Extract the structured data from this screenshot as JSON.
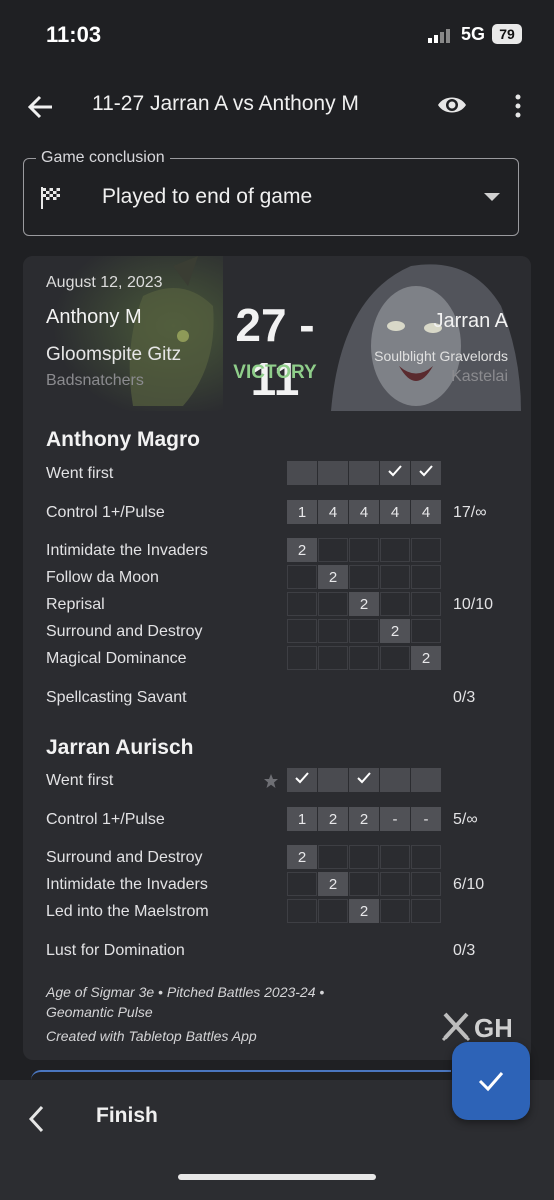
{
  "status_bar": {
    "time": "11:03",
    "network": "5G",
    "battery": "79"
  },
  "app_bar": {
    "title": "11-27 Jarran A vs Anthony M"
  },
  "game_conclusion": {
    "label": "Game conclusion",
    "value": "Played to end of game"
  },
  "summary": {
    "date": "August 12, 2023",
    "score": "27 - 11",
    "result": "VICTORY",
    "player1": {
      "name": "Anthony M",
      "faction": "Gloomspite Gitz",
      "subfaction": "Badsnatchers"
    },
    "player2": {
      "name": "Jarran A",
      "faction": "Soulblight Gravelords",
      "subfaction": "Kastelai"
    }
  },
  "players": [
    {
      "name": "Anthony Magro",
      "went_first_label": "Went first",
      "went_first": [
        false,
        false,
        false,
        true,
        true
      ],
      "control_label": "Control 1+/Pulse",
      "control": [
        "1",
        "4",
        "4",
        "4",
        "4"
      ],
      "control_total": "17/∞",
      "tactics": [
        {
          "label": "Intimidate the Invaders",
          "round": 1,
          "value": "2"
        },
        {
          "label": "Follow da Moon",
          "round": 2,
          "value": "2"
        },
        {
          "label": "Reprisal",
          "round": 3,
          "value": "2"
        },
        {
          "label": "Surround and Destroy",
          "round": 4,
          "value": "2"
        },
        {
          "label": "Magical Dominance",
          "round": 5,
          "value": "2"
        }
      ],
      "tactics_total": "10/10",
      "grand_strategy": "Spellcasting Savant",
      "grand_strategy_total": "0/3"
    },
    {
      "name": "Jarran Aurisch",
      "went_first_label": "Went first",
      "went_first": [
        true,
        false,
        true,
        false,
        false
      ],
      "control_label": "Control 1+/Pulse",
      "control": [
        "1",
        "2",
        "2",
        "-",
        "-"
      ],
      "control_total": "5/∞",
      "tactics": [
        {
          "label": "Surround and Destroy",
          "round": 1,
          "value": "2"
        },
        {
          "label": "Intimidate the Invaders",
          "round": 2,
          "value": "2"
        },
        {
          "label": "Led into the Maelstrom",
          "round": 3,
          "value": "2"
        }
      ],
      "tactics_total": "6/10",
      "grand_strategy": "Lust for Domination",
      "grand_strategy_total": "0/3"
    }
  ],
  "meta_line_1": "Age of Sigmar 3e • Pitched Battles 2023-24 •",
  "meta_line_2": "Geomantic Pulse",
  "created_with": "Created with Tabletop Battles App",
  "logo_text": "GH",
  "bottom_bar": {
    "finish_label": "Finish"
  }
}
